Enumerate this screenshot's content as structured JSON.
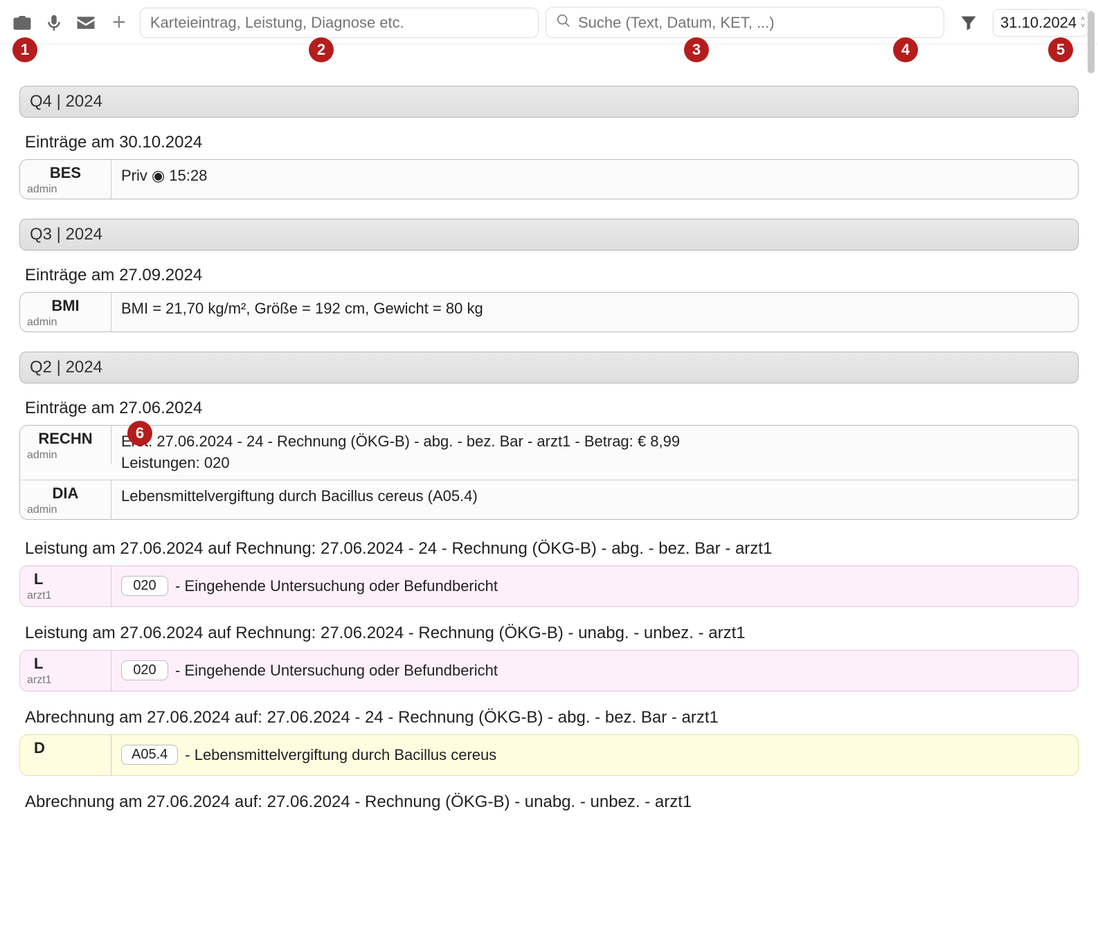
{
  "toolbar": {
    "entry_placeholder": "Karteieintrag, Leistung, Diagnose etc.",
    "search_placeholder": "Suche (Text, Datum, KET, ...)",
    "date_value": "31.10.2024"
  },
  "badges": {
    "b1": "1",
    "b2": "2",
    "b3": "3",
    "b4": "4",
    "b5": "5",
    "b6": "6"
  },
  "quarters": {
    "q4": "Q4 | 2024",
    "q3": "Q3 | 2024",
    "q2": "Q2 | 2024"
  },
  "q4_day": {
    "label": "Einträge am 30.10.2024",
    "entry": {
      "type": "BES",
      "user": "admin",
      "body": "Priv ◉ 15:28"
    }
  },
  "q3_day": {
    "label": "Einträge am 27.09.2024",
    "entry": {
      "type": "BMI",
      "user": "admin",
      "body": "BMI = 21,70 kg/m², Größe = 192 cm, Gewicht = 80 kg"
    }
  },
  "q2_day1": {
    "label": "Einträge am 27.06.2024",
    "entry1": {
      "type": "RECHN",
      "user": "admin",
      "line1": "Erst. 27.06.2024 - 24 - Rechnung (ÖKG-B) - abg. - bez. Bar - arzt1 - Betrag: € 8,99",
      "line2": "Leistungen: 020"
    },
    "entry2": {
      "type": "DIA",
      "user": "admin",
      "body": "Lebensmittelvergiftung durch Bacillus cereus (A05.4)"
    }
  },
  "leistung1": {
    "label": "Leistung am 27.06.2024 auf Rechnung: 27.06.2024 - 24 - Rechnung (ÖKG-B) - abg. - bez. Bar - arzt1",
    "type": "L",
    "user": "arzt1",
    "code": "020",
    "desc": "- Eingehende Untersuchung oder Befundbericht"
  },
  "leistung2": {
    "label": "Leistung am 27.06.2024 auf Rechnung: 27.06.2024 - Rechnung (ÖKG-B) - unabg. - unbez. - arzt1",
    "type": "L",
    "user": "arzt1",
    "code": "020",
    "desc": "- Eingehende Untersuchung oder Befundbericht"
  },
  "abrechnung1": {
    "label": "Abrechnung am 27.06.2024 auf: 27.06.2024 - 24 - Rechnung (ÖKG-B) - abg. - bez. Bar - arzt1",
    "type": "D",
    "code": "A05.4",
    "desc": "- Lebensmittelvergiftung durch Bacillus cereus"
  },
  "abrechnung2": {
    "label": "Abrechnung am 27.06.2024 auf: 27.06.2024 - Rechnung (ÖKG-B) - unabg. - unbez. - arzt1"
  }
}
